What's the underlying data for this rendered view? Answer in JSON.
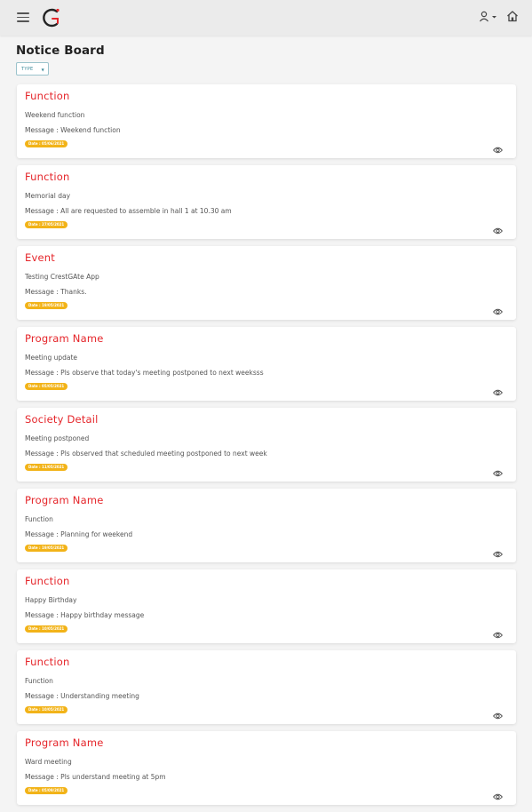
{
  "header": {
    "menu_icon": "hamburger-icon",
    "logo_icon": "brand-logo-c",
    "user_icon": "user-icon",
    "home_icon": "home-icon"
  },
  "page": {
    "title": "Notice Board",
    "type_filter_label": "TYPE"
  },
  "colors": {
    "title_red": "#e5252a",
    "badge_yellow": "#f2b318",
    "filter_teal": "#3d8a9a"
  },
  "notices": [
    {
      "title": "Function",
      "subject": "Weekend function",
      "message": "Message : Weekend function",
      "date": "Date : 05/06/2021"
    },
    {
      "title": "Function",
      "subject": "Memorial day",
      "message": "Message : All are requested to assemble in hall 1 at 10.30 am",
      "date": "Date : 27/05/2021"
    },
    {
      "title": "Event",
      "subject": "Testing CrestGAte App",
      "message": "Message : Thanks.",
      "date": "Date : 19/05/2021"
    },
    {
      "title": "Program Name",
      "subject": "Meeting update",
      "message": "Message : Pls observe that today's meeting postponed to next weeksss",
      "date": "Date : 05/05/2021"
    },
    {
      "title": "Society Detail",
      "subject": "Meeting postponed",
      "message": "Message : Pls observed that scheduled meeting postponed to next week",
      "date": "Date : 11/05/2021"
    },
    {
      "title": "Program Name",
      "subject": "Function",
      "message": "Message : Planning for weekend",
      "date": "Date : 19/05/2021"
    },
    {
      "title": "Function",
      "subject": "Happy Birthday",
      "message": "Message : Happy birthday message",
      "date": "Date : 10/05/2021"
    },
    {
      "title": "Function",
      "subject": "Function",
      "message": "Message : Understanding meeting",
      "date": "Date : 10/05/2021"
    },
    {
      "title": "Program Name",
      "subject": "Ward meeting",
      "message": "Message : Pls understand meeting at 5pm",
      "date": "Date : 05/09/2021"
    }
  ]
}
